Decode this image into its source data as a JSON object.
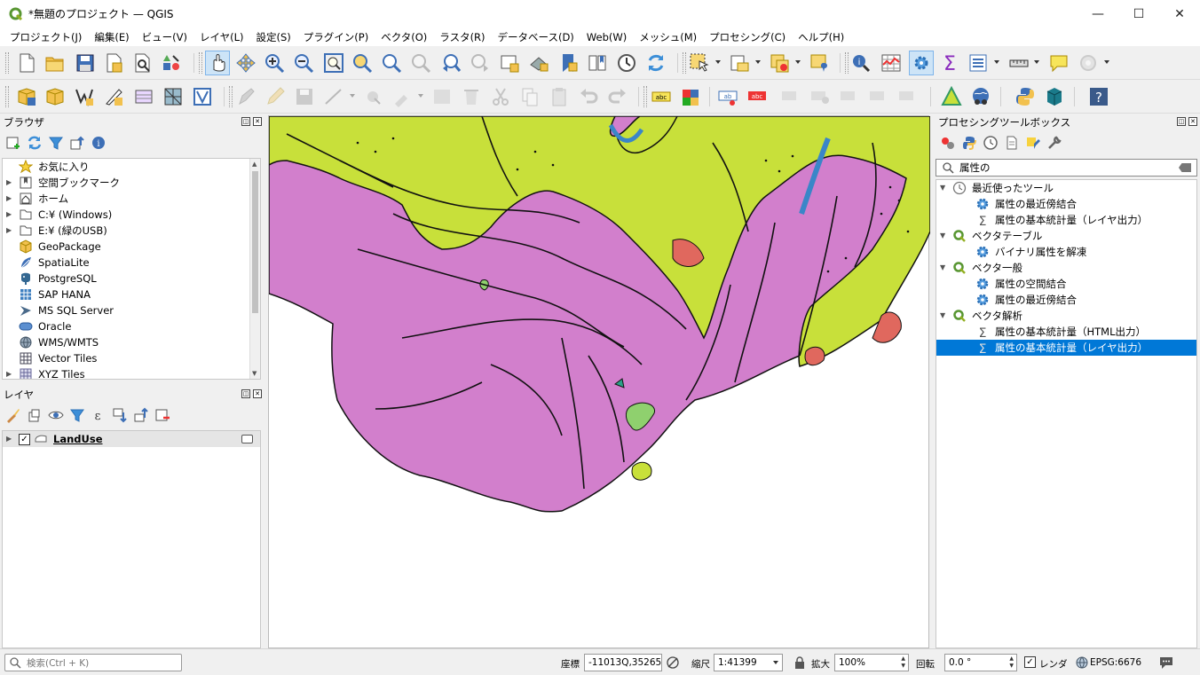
{
  "window": {
    "title": "*無題のプロジェクト — QGIS",
    "minimize": "—",
    "maximize": "☐",
    "close": "✕"
  },
  "menu": [
    "プロジェクト(J)",
    "編集(E)",
    "ビュー(V)",
    "レイヤ(L)",
    "設定(S)",
    "プラグイン(P)",
    "ベクタ(O)",
    "ラスタ(R)",
    "データベース(D)",
    "Web(W)",
    "メッシュ(M)",
    "プロセシング(C)",
    "ヘルプ(H)"
  ],
  "browser": {
    "title": "ブラウザ",
    "items": [
      {
        "label": "お気に入り",
        "icon": "star-icon",
        "expand": false
      },
      {
        "label": "空間ブックマーク",
        "icon": "bookmark-icon",
        "expand": true
      },
      {
        "label": "ホーム",
        "icon": "home-icon",
        "expand": true
      },
      {
        "label": "C:¥ (Windows)",
        "icon": "drive-icon",
        "expand": true
      },
      {
        "label": "E:¥ (緑のUSB)",
        "icon": "drive-icon",
        "expand": true
      },
      {
        "label": "GeoPackage",
        "icon": "geopackage-icon",
        "expand": false
      },
      {
        "label": "SpatiaLite",
        "icon": "spatialite-icon",
        "expand": false
      },
      {
        "label": "PostgreSQL",
        "icon": "postgresql-icon",
        "expand": false
      },
      {
        "label": "SAP HANA",
        "icon": "saphana-icon",
        "expand": false
      },
      {
        "label": "MS SQL Server",
        "icon": "mssql-icon",
        "expand": false
      },
      {
        "label": "Oracle",
        "icon": "oracle-icon",
        "expand": false
      },
      {
        "label": "WMS/WMTS",
        "icon": "wms-icon",
        "expand": false
      },
      {
        "label": "Vector Tiles",
        "icon": "vector-tiles-icon",
        "expand": false
      },
      {
        "label": "XYZ Tiles",
        "icon": "xyz-tiles-icon",
        "expand": false
      }
    ]
  },
  "layers": {
    "title": "レイヤ",
    "items": [
      {
        "label": "LandUse",
        "checked": true
      }
    ]
  },
  "toolbox": {
    "title": "プロセシングツールボックス",
    "search": "属性の",
    "groups": [
      {
        "label": "最近使ったツール",
        "icon": "clock-icon",
        "items": [
          {
            "label": "属性の最近傍結合",
            "icon": "gear-icon"
          },
          {
            "label": "属性の基本統計量（レイヤ出力）",
            "icon": "sigma-icon"
          }
        ]
      },
      {
        "label": "ベクタテーブル",
        "icon": "qgis-icon",
        "items": [
          {
            "label": "バイナリ属性を解凍",
            "icon": "gear-icon"
          }
        ]
      },
      {
        "label": "ベクタ一般",
        "icon": "qgis-icon",
        "items": [
          {
            "label": "属性の空間結合",
            "icon": "gear-icon"
          },
          {
            "label": "属性の最近傍結合",
            "icon": "gear-icon"
          }
        ]
      },
      {
        "label": "ベクタ解析",
        "icon": "qgis-icon",
        "items": [
          {
            "label": "属性の基本統計量（HTML出力）",
            "icon": "sigma-icon"
          },
          {
            "label": "属性の基本統計量（レイヤ出力）",
            "icon": "sigma-icon",
            "selected": true
          }
        ]
      }
    ]
  },
  "status": {
    "search_placeholder": "検索(Ctrl + K)",
    "coord_label": "座標",
    "coord_value": "-11013Q,35265",
    "scale_label": "縮尺",
    "scale_value": "1:41399",
    "magnify_label": "拡大",
    "magnify_value": "100%",
    "rotation_label": "回転",
    "rotation_value": "0.0 °",
    "render_label": "レンダ",
    "crs": "EPSG:6676"
  },
  "colors": {
    "accent": "#0078d7",
    "landuse_pink": "#d27fcc",
    "landuse_yellow": "#c8e03a",
    "landuse_red": "#e0685e",
    "landuse_green": "#8fd06e",
    "landuse_blue": "#3a86c8"
  }
}
